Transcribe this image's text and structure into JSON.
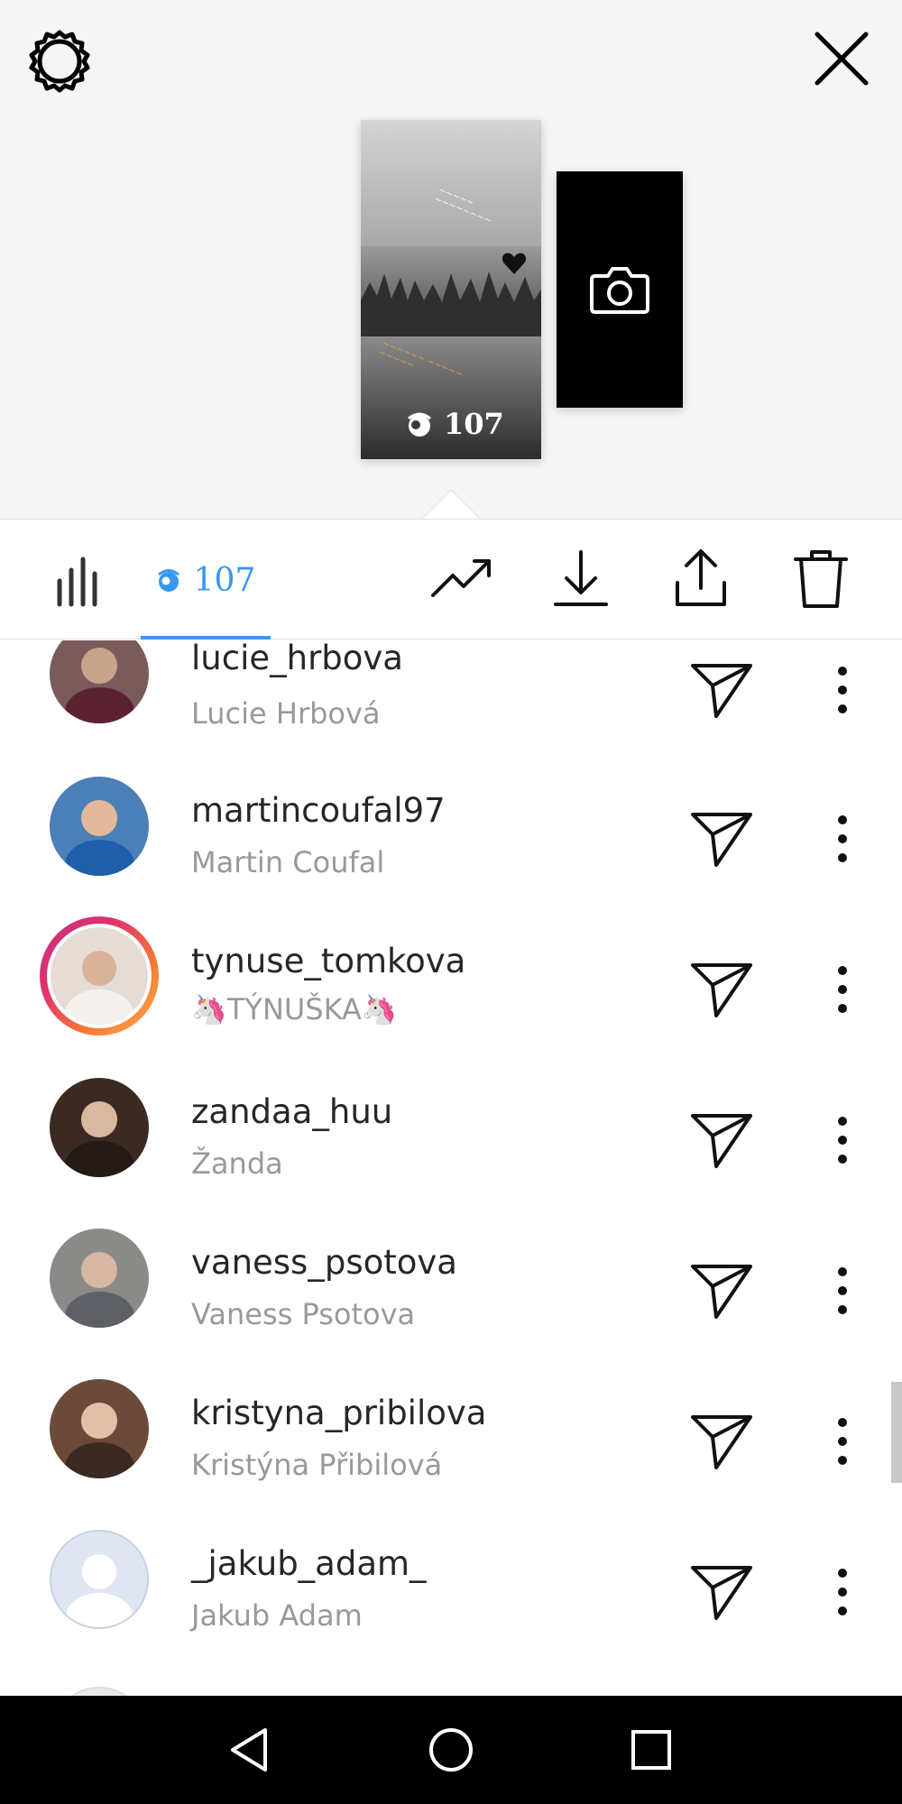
{
  "story": {
    "view_count": "107"
  },
  "toolbar": {
    "views_count": "107"
  },
  "viewers": [
    {
      "username": "lucie_hrbova",
      "full_name": "Lucie Hrbová",
      "avatar_color": "#7a5a5a"
    },
    {
      "username": "martincoufal97",
      "full_name": "Martin Coufal",
      "avatar_color": "#4b7fb8"
    },
    {
      "username": "tynuse_tomkova",
      "full_name": "🦄TÝNUŠKA🦄",
      "avatar_color": "#e6dcd6",
      "has_story_ring": true
    },
    {
      "username": "zandaa_huu",
      "full_name": "Žanda",
      "avatar_color": "#3a2a22"
    },
    {
      "username": "vaness_psotova",
      "full_name": "Vaness Psotova",
      "avatar_color": "#8a8a88"
    },
    {
      "username": "kristyna_pribilova",
      "full_name": "Kristýna Přibilová",
      "avatar_color": "#6b4a3a"
    },
    {
      "username": "_jakub_adam_",
      "full_name": "Jakub Adam",
      "avatar_color": "#dfe6f2",
      "default_avatar": true
    }
  ],
  "colors": {
    "accent_blue": "#3897f0",
    "text_primary": "#262626",
    "text_secondary": "#999999"
  }
}
